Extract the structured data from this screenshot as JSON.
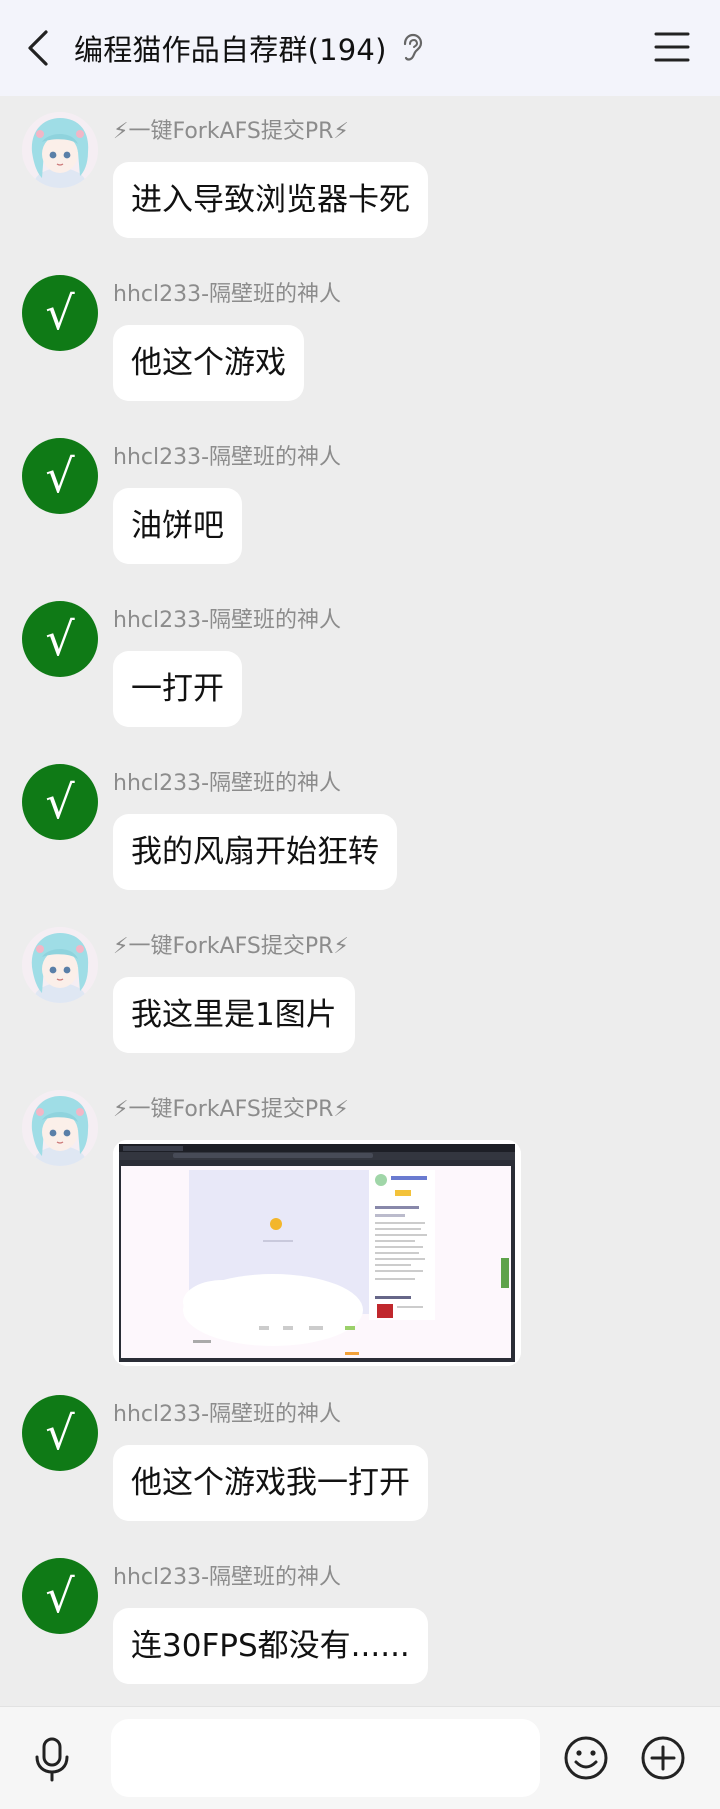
{
  "header": {
    "title": "编程猫作品自荐群(194)",
    "back_icon": "chevron-left-icon",
    "ear_icon": "ear-icon",
    "menu_icon": "hamburger-menu-icon"
  },
  "messages": [
    {
      "sender": "⚡一键ForkAFS提交PR⚡",
      "avatar": "anime-girl-avatar",
      "text": "进入导致浏览器卡死"
    },
    {
      "sender": "hhcl233-隔壁班的神人",
      "avatar": "check-mark-avatar",
      "text": "他这个游戏"
    },
    {
      "sender": "hhcl233-隔壁班的神人",
      "avatar": "check-mark-avatar",
      "text": "油饼吧"
    },
    {
      "sender": "hhcl233-隔壁班的神人",
      "avatar": "check-mark-avatar",
      "text": "一打开"
    },
    {
      "sender": "hhcl233-隔壁班的神人",
      "avatar": "check-mark-avatar",
      "text": "我的风扇开始狂转"
    },
    {
      "sender": "⚡一键ForkAFS提交PR⚡",
      "avatar": "anime-girl-avatar",
      "text": "我这里是1图片"
    },
    {
      "sender": "⚡一键ForkAFS提交PR⚡",
      "avatar": "anime-girl-avatar",
      "image": "browser-screenshot-thumbnail"
    },
    {
      "sender": "hhcl233-隔壁班的神人",
      "avatar": "check-mark-avatar",
      "text": "他这个游戏我一打开"
    },
    {
      "sender": "hhcl233-隔壁班的神人",
      "avatar": "check-mark-avatar",
      "text": "连30FPS都没有......"
    }
  ],
  "avatar_mark": "√",
  "input": {
    "placeholder": "",
    "value": ""
  },
  "bottom_icons": {
    "mic": "microphone-icon",
    "emoji": "smiley-face-icon",
    "plus": "plus-circle-icon"
  },
  "colors": {
    "avatar_green": "#0f7a16",
    "background": "#ededed",
    "header": "#f3f4fb"
  }
}
